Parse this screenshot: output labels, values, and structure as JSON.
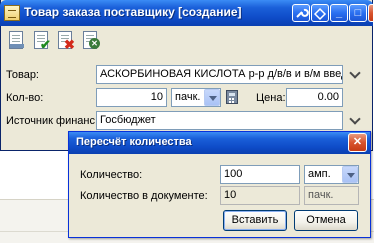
{
  "window": {
    "title": "Товар заказа поставщику [создание]",
    "title_buttons": {
      "minimize": "_",
      "maximize": "□",
      "close": "✕"
    }
  },
  "form": {
    "product_label": "Товар:",
    "product_value": "АСКОРБИНОВАЯ КИСЛОТА р-р д/в/в и в/м введения",
    "qty_label": "Кол-во:",
    "qty_value": "10",
    "qty_unit": "пачк.",
    "price_label": "Цена:",
    "price_value": "0.00",
    "funding_label": "Источник финанс.:",
    "funding_value": "Госбюджет"
  },
  "dialog": {
    "title": "Пересчёт количества",
    "close_label": "✕",
    "qty_label": "Количество:",
    "qty_value": "100",
    "qty_unit": "амп.",
    "doc_qty_label": "Количество в документе:",
    "doc_qty_value": "10",
    "doc_qty_unit": "пачк.",
    "insert_button": "Вставить",
    "cancel_button": "Отмена"
  },
  "icons": {
    "toolbar": [
      "new-doc-icon",
      "save-check-icon",
      "delete-icon",
      "close-doc-icon"
    ],
    "title": [
      "wrench-icon",
      "view-icon"
    ]
  },
  "colors": {
    "title_bar": "#0e4bc7",
    "window_bg": "#ece9d8",
    "close_button": "#d8542e",
    "accent_field_border": "#7f9db9"
  }
}
